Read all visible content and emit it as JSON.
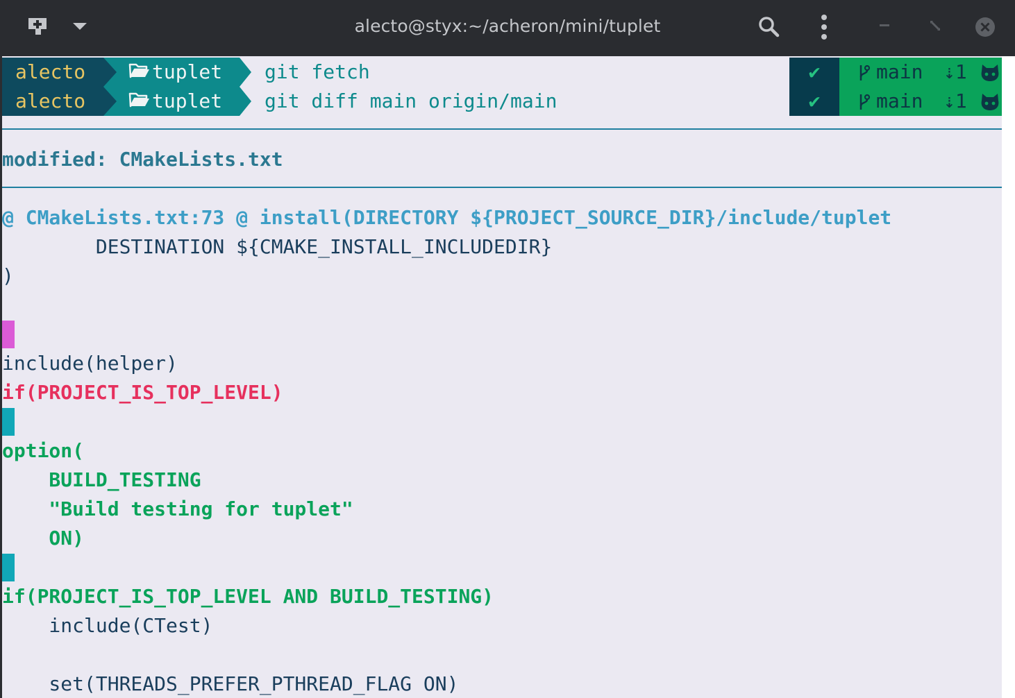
{
  "window": {
    "title": "alecto@styx:~/acheron/mini/tuplet"
  },
  "prompt_lines": [
    {
      "user": "alecto",
      "dir": "tuplet",
      "command": "git fetch",
      "status": "✔",
      "branch": "main",
      "behind": "⇣1"
    },
    {
      "user": "alecto",
      "dir": "tuplet",
      "command": "git diff main origin/main",
      "status": "✔",
      "branch": "main",
      "behind": "⇣1"
    }
  ],
  "diff": {
    "file_header": "modified: CMakeLists.txt",
    "hunk_header": "@ CMakeLists.txt:73 @ install(DIRECTORY ${PROJECT_SOURCE_DIR}/include/tuplet",
    "lines": [
      {
        "text": "        DESTINATION ${CMAKE_INSTALL_INCLUDEDIR}",
        "kind": "ctx"
      },
      {
        "text": ")",
        "kind": "ctx"
      },
      {
        "text": "",
        "kind": "blank"
      },
      {
        "text": "",
        "kind": "marker-del"
      },
      {
        "text": "include(helper)",
        "kind": "ctx"
      },
      {
        "text": "if(PROJECT_IS_TOP_LEVEL)",
        "kind": "del"
      },
      {
        "text": "",
        "kind": "marker-add"
      },
      {
        "text": "option(",
        "kind": "add"
      },
      {
        "text": "    BUILD_TESTING",
        "kind": "add"
      },
      {
        "text": "    \"Build testing for tuplet\"",
        "kind": "add"
      },
      {
        "text": "    ON)",
        "kind": "add"
      },
      {
        "text": "",
        "kind": "marker-add"
      },
      {
        "text": "if(PROJECT_IS_TOP_LEVEL AND BUILD_TESTING)",
        "kind": "add"
      },
      {
        "text": "    include(CTest)",
        "kind": "ctx"
      },
      {
        "text": "",
        "kind": "blank"
      },
      {
        "text": "    set(THREADS_PREFER_PTHREAD_FLAG ON)",
        "kind": "ctx"
      }
    ]
  },
  "colors": {
    "marker_del": "#db5bd6",
    "marker_add": "#11a7b7"
  },
  "icons": [
    "new-tab-icon",
    "dropdown-icon",
    "search-icon",
    "kebab-menu-icon",
    "minimize-icon",
    "maximize-icon",
    "close-icon",
    "folder-icon",
    "branch-icon",
    "github-cat-icon"
  ]
}
